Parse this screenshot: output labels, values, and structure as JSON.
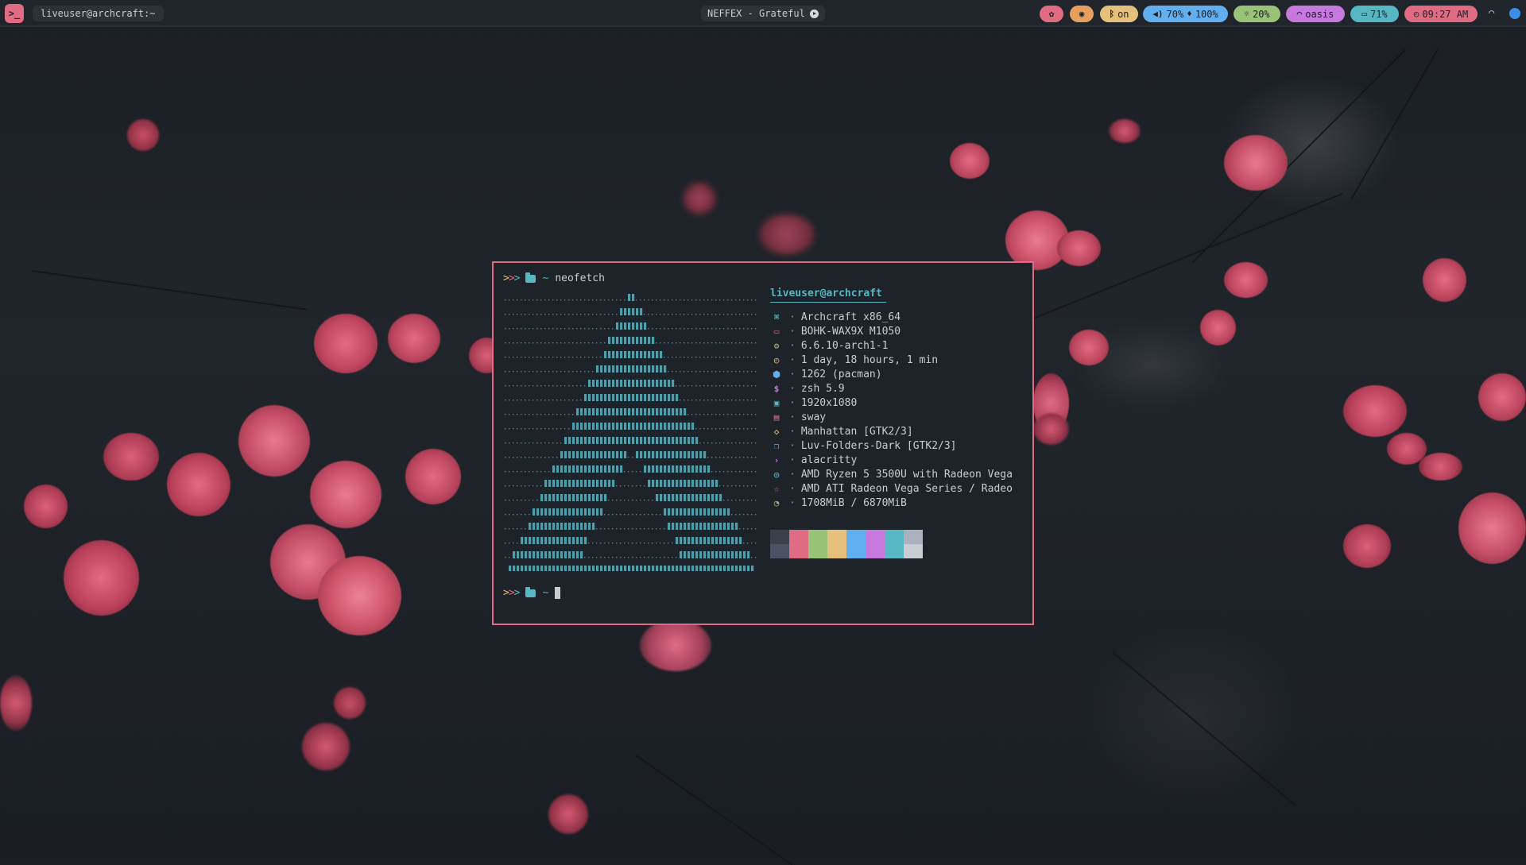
{
  "topbar": {
    "launcher_icon": "terminal-icon",
    "window_title": "liveuser@archcraft:~",
    "media": {
      "text": "NEFFEX - Grateful",
      "icon": "play-circle-icon"
    },
    "bluetooth": {
      "icon": "bluetooth-icon",
      "text": "on",
      "color": "#e5c07b"
    },
    "volume": {
      "icon": "volume-icon",
      "text": "70%",
      "color": "#61afef"
    },
    "mic": {
      "icon": "microphone-icon",
      "text": "100%",
      "color": "#61afef"
    },
    "brightness": {
      "icon": "brightness-icon",
      "text": "20%",
      "color": "#98c379"
    },
    "network": {
      "icon": "wifi-icon",
      "text": "oasis",
      "color": "#c678dd"
    },
    "battery": {
      "icon": "battery-icon",
      "text": "71%",
      "color": "#56b6c2"
    },
    "clock": {
      "icon": "clock-icon",
      "text": "09:27 AM",
      "color": "#e06c84"
    },
    "color_picker_color": "#e06c84",
    "eye_toggle_color": "#e5a060"
  },
  "terminal": {
    "prompt_symbol": ">>>",
    "cwd": "~",
    "command": "neofetch",
    "user_host": "liveuser@archcraft",
    "info": [
      {
        "icon": "command-icon",
        "color": "#56b6c2",
        "value": "Archcraft x86_64"
      },
      {
        "icon": "monitor-icon",
        "color": "#e06c84",
        "value": "BOHK-WAX9X M1050"
      },
      {
        "icon": "gear-icon",
        "color": "#98c379",
        "value": "6.6.10-arch1-1"
      },
      {
        "icon": "clock-icon",
        "color": "#e5c07b",
        "value": "1 day, 18 hours, 1 min"
      },
      {
        "icon": "package-icon",
        "color": "#61afef",
        "value": "1262 (pacman)"
      },
      {
        "icon": "dollar-icon",
        "color": "#c678dd",
        "value": "zsh 5.9"
      },
      {
        "icon": "image-icon",
        "color": "#56b6c2",
        "value": "1920x1080"
      },
      {
        "icon": "window-icon",
        "color": "#e06c84",
        "value": "sway"
      },
      {
        "icon": "drop-icon",
        "color": "#e5c07b",
        "value": "Manhattan [GTK2/3]"
      },
      {
        "icon": "copy-icon",
        "color": "#61afef",
        "value": "Luv-Folders-Dark [GTK2/3]"
      },
      {
        "icon": "prompt-icon",
        "color": "#c678dd",
        "value": "alacritty"
      },
      {
        "icon": "cpu-icon",
        "color": "#56b6c2",
        "value": "AMD Ryzen 5 3500U with Radeon Vega"
      },
      {
        "icon": "star-icon",
        "color": "#e06c84",
        "value": "AMD ATI Radeon Vega Series / Radeo"
      },
      {
        "icon": "memory-icon",
        "color": "#98c379",
        "value": "1708MiB / 6870MiB"
      }
    ],
    "palette_top": [
      "#3a3f4b",
      "#e06c84",
      "#98c379",
      "#e5c07b",
      "#61afef",
      "#c678dd",
      "#56b6c2",
      "#abb2bf"
    ],
    "palette_bottom": [
      "#4b5263",
      "#e06c84",
      "#98c379",
      "#e5c07b",
      "#61afef",
      "#c678dd",
      "#56b6c2",
      "#c8ccd4"
    ],
    "ascii_color": "#56b6c2"
  }
}
